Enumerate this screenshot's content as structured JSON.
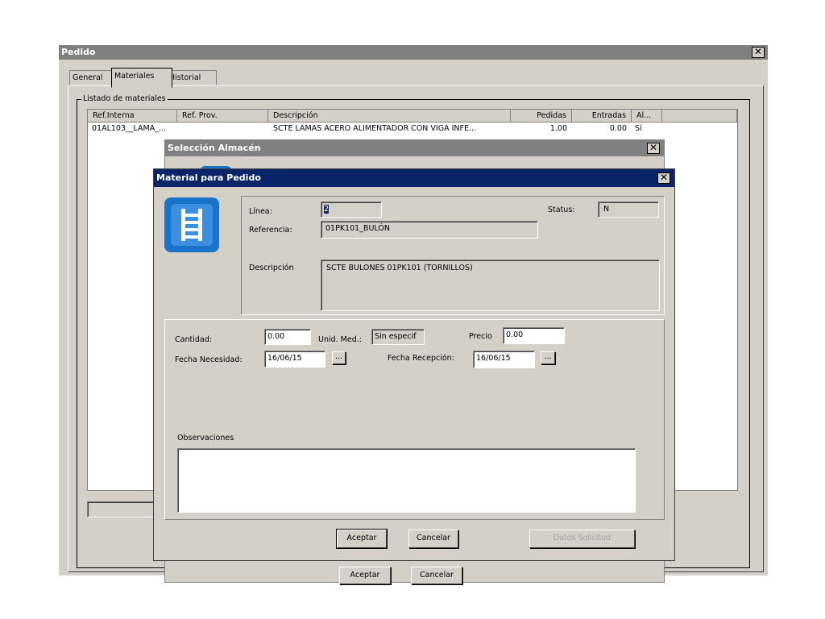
{
  "pedido": {
    "title": "Pedido",
    "close_glyph": "✕",
    "tabs": [
      {
        "label": "General"
      },
      {
        "label": "Materiales"
      },
      {
        "label": "Historial"
      }
    ],
    "group_label": "Listado de materiales",
    "columns": [
      "Ref.Interna",
      "Ref. Prov.",
      "Descripción",
      "Pedidas",
      "Entradas",
      "Al..."
    ],
    "rows": [
      {
        "ref_interna": "01AL103__LAMA_...",
        "ref_prov": "",
        "descripcion": "SCTE LAMAS ACERO ALIMENTADOR CON VIGA INFE...",
        "pedidas": "1.00",
        "entradas": "0.00",
        "al": "Sí"
      }
    ]
  },
  "seleccion_almacen": {
    "title": "Selección Almacén",
    "close_glyph": "✕",
    "buttons": [
      "Aceptar",
      "Cancelar"
    ]
  },
  "material_dialog": {
    "title": "Material para Pedido",
    "close_glyph": "✕",
    "icon": "ladder-icon",
    "linea_label": "Línea:",
    "linea_value": "2",
    "status_label": "Status:",
    "status_value": "N",
    "referencia_label": "Referencia:",
    "referencia_value": "01PK101_BULÓN",
    "descripcion_label": "Descripción",
    "descripcion_value": "SCTE BULONES 01PK101 (TORNILLOS)",
    "cantidad_label": "Cantidad:",
    "cantidad_value": "0.00",
    "unid_med_label": "Unid. Med.:",
    "unid_med_value": "Sin especif",
    "precio_label": "Precio",
    "precio_value": "0.00",
    "fecha_necesidad_label": "Fecha Necesidad:",
    "fecha_necesidad_value": "16/06/15",
    "fecha_recepcion_label": "Fecha Recepción:",
    "fecha_recepcion_value": "16/06/15",
    "picker_label": "...",
    "observaciones_label": "Observaciones",
    "observaciones_value": "",
    "aceptar_label": "Aceptar",
    "cancelar_label": "Cancelar",
    "datos_solicitud_label": "Datos Solicitud"
  },
  "colors": {
    "dialog_face": "#d4d0c8",
    "active_title": "#0a246a",
    "inactive_title": "#808080",
    "icon_blue": "#1a73c9"
  }
}
